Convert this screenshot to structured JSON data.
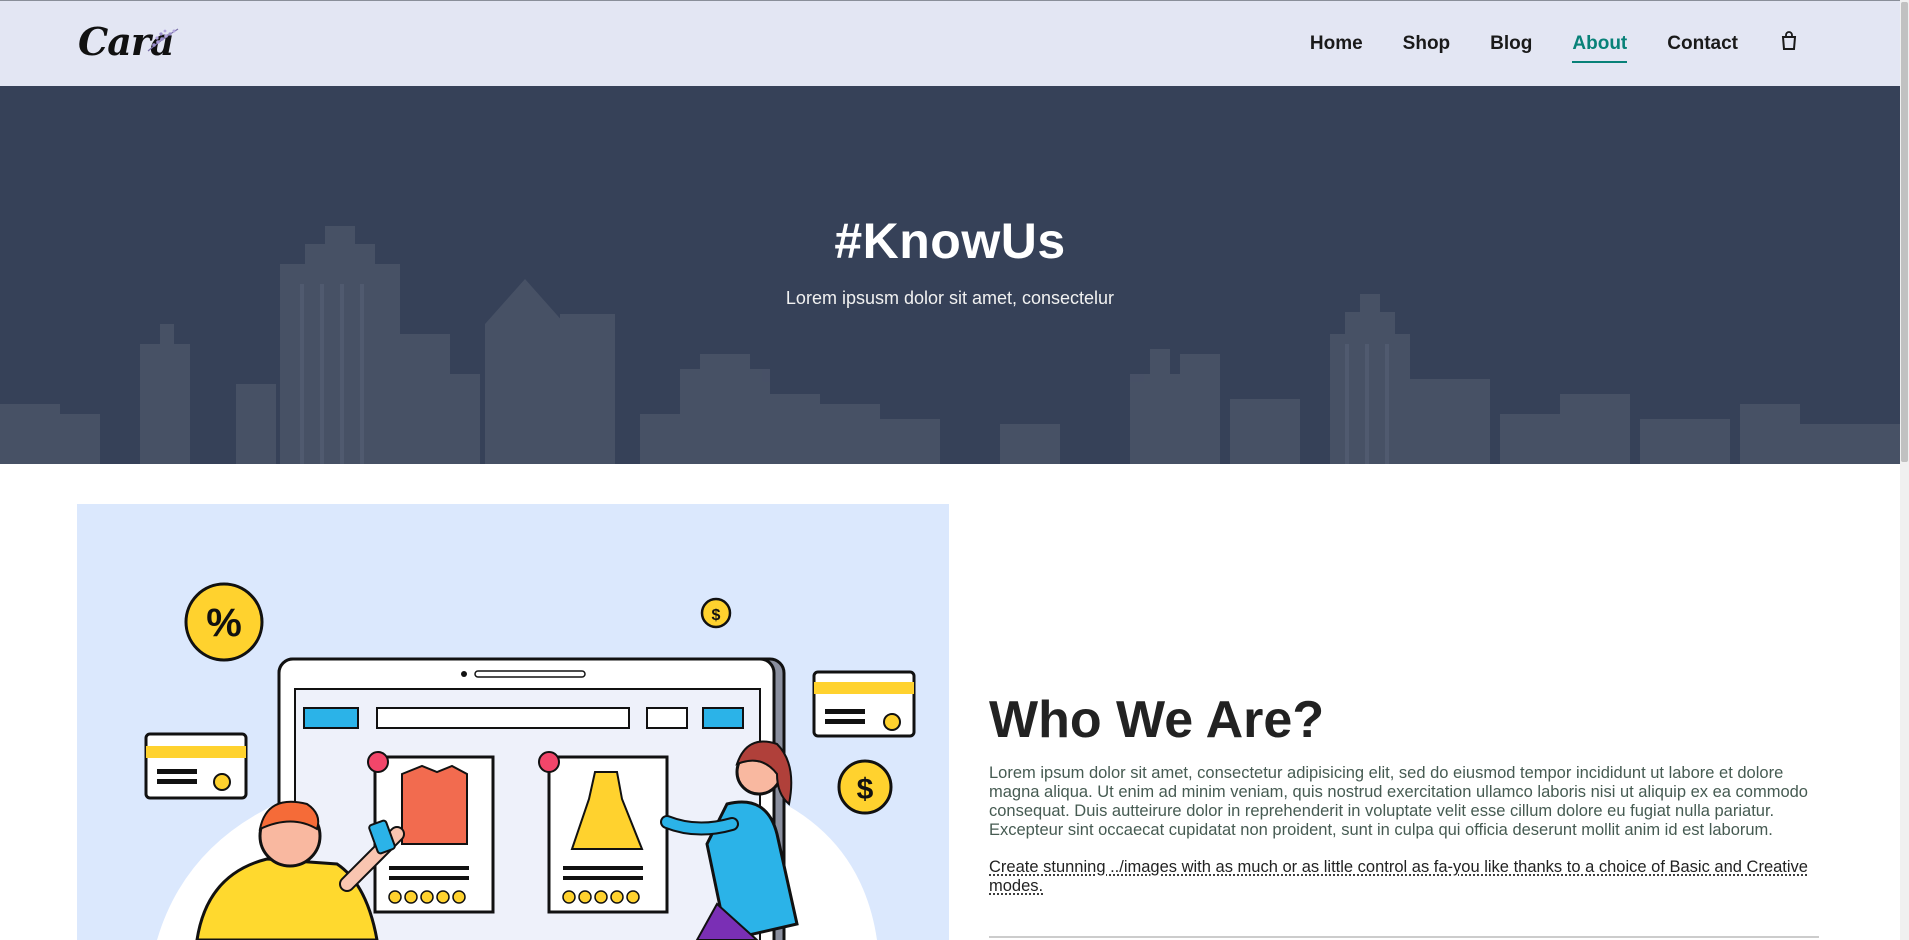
{
  "brand": {
    "logo_text": "Cara"
  },
  "nav": {
    "items": [
      {
        "label": "Home",
        "active": false
      },
      {
        "label": "Shop",
        "active": false
      },
      {
        "label": "Blog",
        "active": false
      },
      {
        "label": "About",
        "active": true
      },
      {
        "label": "Contact",
        "active": false
      }
    ],
    "cart_icon": "shopping-bag-icon",
    "active_color": "#088178"
  },
  "hero": {
    "title": "#KnowUs",
    "subtitle": "Lorem ipsusm dolor sit amet, consectelur"
  },
  "about": {
    "title": "Who We Are?",
    "paragraph": "Lorem ipsum dolor sit amet, consectetur adipisicing elit, sed do eiusmod tempor incididunt ut labore et dolore magna aliqua. Ut enim ad minim veniam, quis nostrud exercitation ullamco laboris nisi ut aliquip ex ea commodo consequat. Duis autteirure dolor in reprehenderit in voluptate velit esse cillum dolore eu fugiat nulla pariatur. Excepteur sint occaecat cupidatat non proident, sunt in culpa qui officia deserunt mollit anim id est laborum.",
    "link_text": "Create stunning ../images with as much or as little control as fa-you like thanks to a choice of Basic and Creative modes."
  },
  "colors": {
    "header_bg": "#e3e6f3",
    "hero_bg": "#364158",
    "illustration_bg": "#dbe8fd"
  }
}
